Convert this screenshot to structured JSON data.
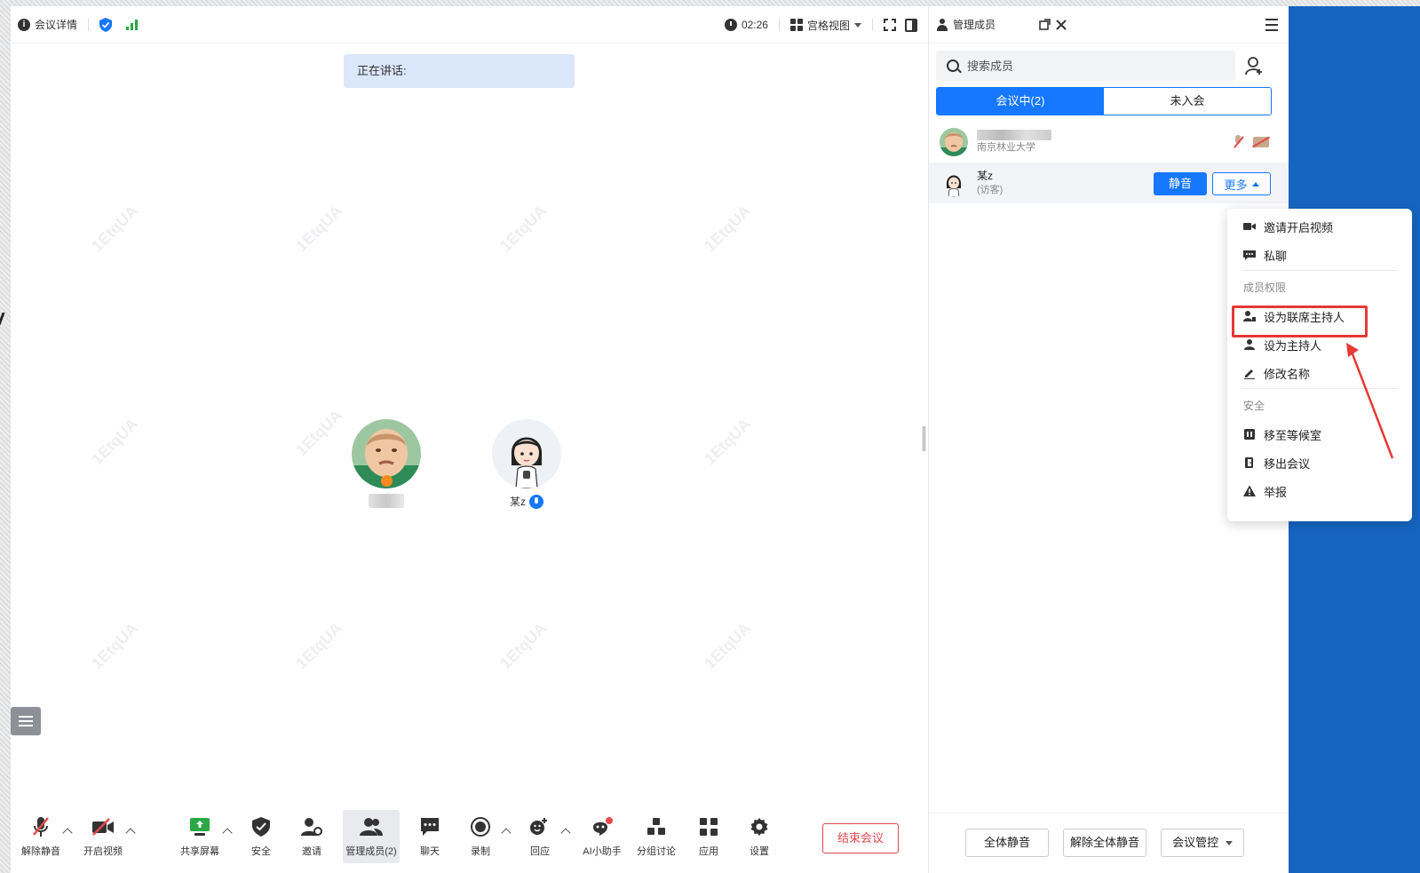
{
  "topbar": {
    "meeting_details": "会议详情",
    "timer": "02:26",
    "view_mode": "宫格视图"
  },
  "speaking_label": "正在讲话:",
  "participants_stage": [
    {
      "name": "",
      "avatar": "baby-photo",
      "host": true
    },
    {
      "name": "某z",
      "avatar": "cartoon-girl",
      "mic": "on"
    }
  ],
  "watermark_text": "1EtqUA",
  "toolbar": {
    "items": [
      "解除静音",
      "开启视频",
      "共享屏幕",
      "安全",
      "邀请",
      "管理成员(2)",
      "聊天",
      "录制",
      "回应",
      "AI小助手",
      "分组讨论",
      "应用",
      "设置"
    ],
    "end_meeting": "结束会议"
  },
  "panel": {
    "title": "管理成员",
    "search_placeholder": "搜索成员",
    "tabs": [
      "会议中(2)",
      "未入会"
    ],
    "members": [
      {
        "name": "",
        "org": "南京林业大学"
      },
      {
        "name": "某z",
        "role": "(访客)",
        "mute_label": "静音",
        "more_label": "更多"
      }
    ],
    "bottom": {
      "mute_all": "全体静音",
      "unmute_all": "解除全体静音",
      "meeting_control": "会议管控"
    }
  },
  "dropdown": {
    "items_top": [
      "邀请开启视频",
      "私聊"
    ],
    "section_permissions": "成员权限",
    "items_permissions": [
      "设为联席主持人",
      "设为主持人",
      "修改名称"
    ],
    "section_security": "安全",
    "items_security": [
      "移至等候室",
      "移出会议",
      "举报"
    ],
    "highlighted": "设为联席主持人"
  },
  "colors": {
    "accent": "#1677ff",
    "danger": "#e5484d",
    "annotation": "#e53935",
    "side_blue": "#1565c0"
  }
}
